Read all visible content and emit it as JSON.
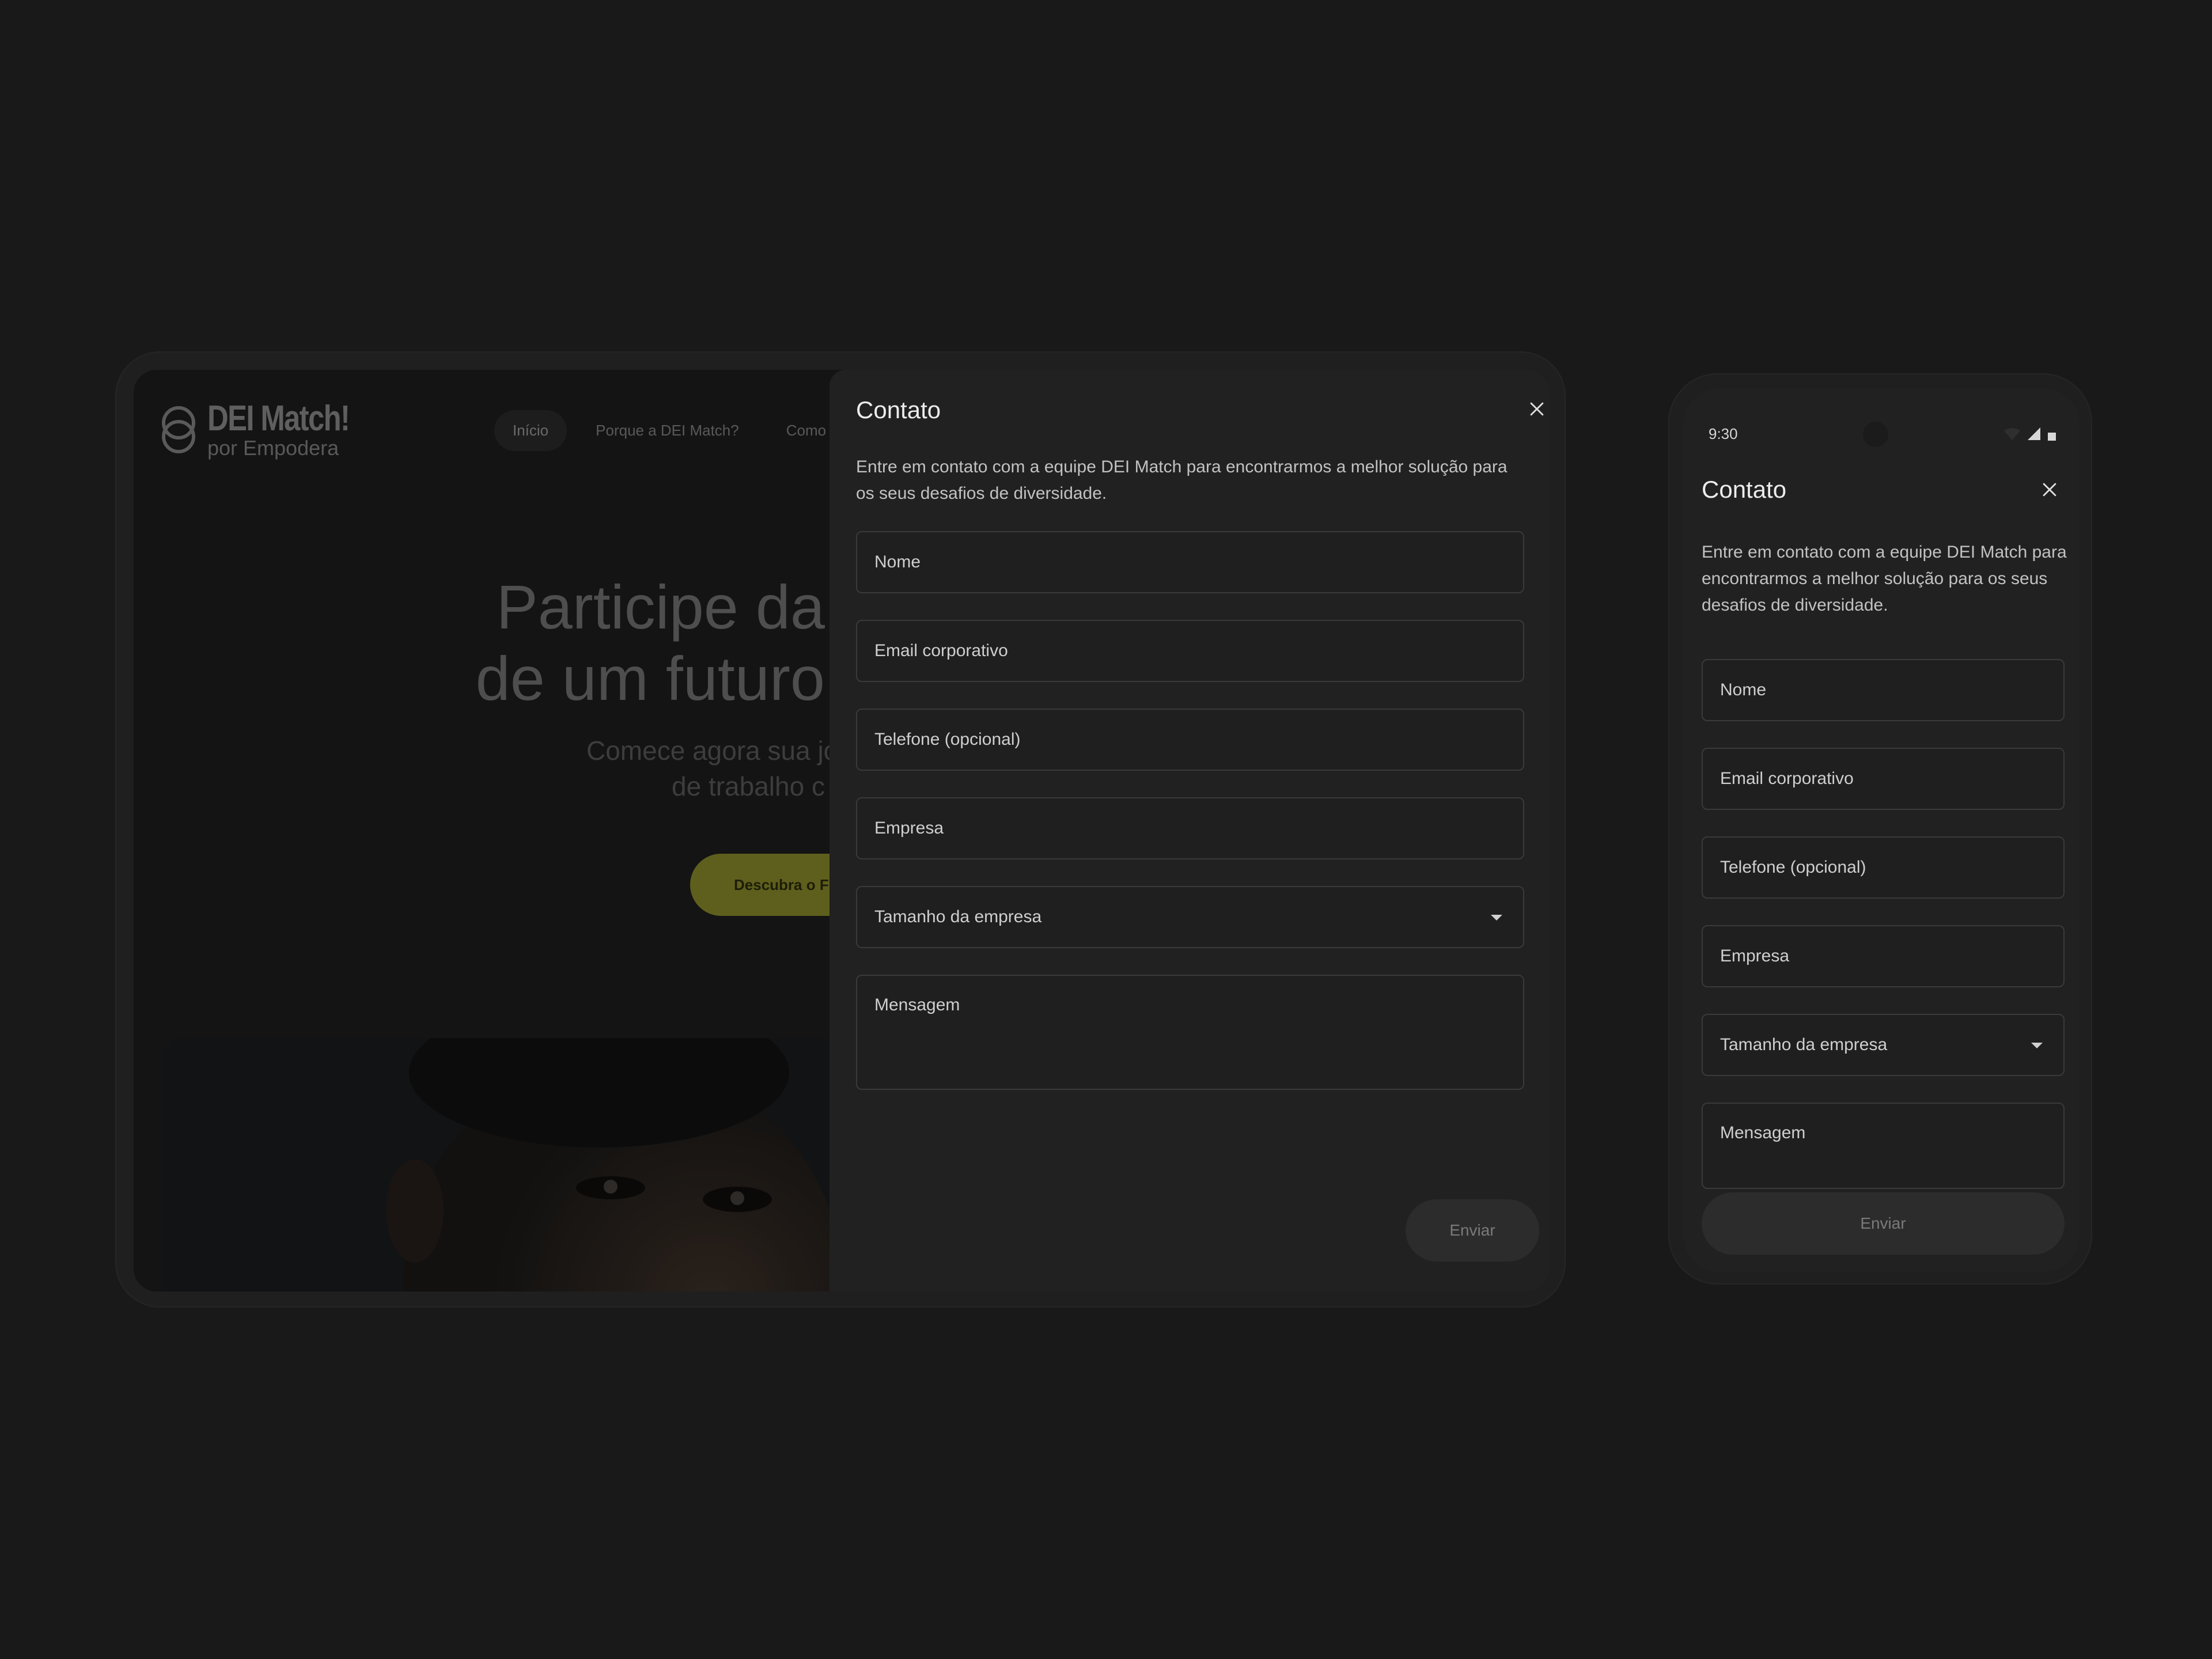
{
  "site": {
    "logo_title": "DEI Match!",
    "logo_subtitle": "por Empodera",
    "nav": [
      {
        "label": "Início"
      },
      {
        "label": "Porque a DEI Match?"
      },
      {
        "label": "Como f"
      }
    ],
    "hero_line1": "Participe da",
    "hero_line2": "de um futuro",
    "hero_sub1": "Comece agora sua jo",
    "hero_sub2": "de trabalho c",
    "cta_label": "Descubra o Fe"
  },
  "modal": {
    "title": "Contato",
    "description": "Entre em contato com a equipe DEI Match para encontrarmos a melhor solução para os seus desafios de diversidade.",
    "fields": {
      "name": "Nome",
      "email": "Email corporativo",
      "phone": "Telefone (opcional)",
      "company": "Empresa",
      "company_size": "Tamanho da empresa",
      "message": "Mensagem"
    },
    "submit_label": "Enviar"
  },
  "phone": {
    "status_time": "9:30"
  },
  "colors": {
    "background": "#191919",
    "sheet": "#212121",
    "cta": "#5e5f1d"
  }
}
